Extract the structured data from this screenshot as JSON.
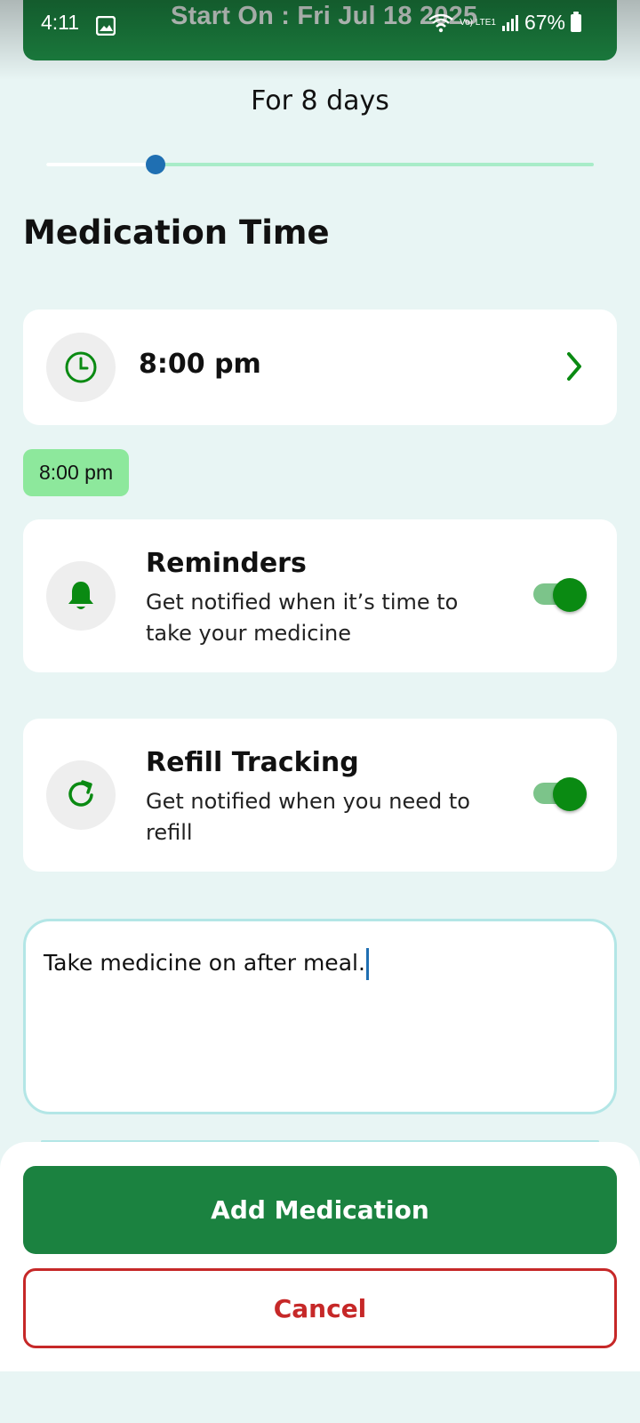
{
  "status_bar": {
    "time": "4:11",
    "network": "Vo) LTE1",
    "battery": "67%"
  },
  "header": {
    "title": "Start On : Fri Jul 18 2025"
  },
  "duration": {
    "label": "For 8 days",
    "slider_fraction": 0.2
  },
  "section": {
    "title": "Medication Time"
  },
  "time_card": {
    "value": "8:00 pm"
  },
  "time_chips": [
    "8:00 pm"
  ],
  "reminders": {
    "title": "Reminders",
    "description": "Get notified when it’s time to take your medicine",
    "enabled": true
  },
  "refill": {
    "title": "Refill Tracking",
    "description": "Get notified when you need to refill",
    "enabled": true
  },
  "notes": {
    "value": "Take medicine on after meal."
  },
  "actions": {
    "primary_label": "Add Medication",
    "cancel_label": "Cancel"
  },
  "colors": {
    "primary": "#1b8240",
    "accent_green": "#0a8a12",
    "danger": "#c62828",
    "chip": "#8de89c",
    "background": "#e8f5f4"
  },
  "icons": {
    "clock": "clock-icon",
    "bell": "bell-icon",
    "refresh": "refresh-icon",
    "chevron": "chevron-right-icon"
  }
}
